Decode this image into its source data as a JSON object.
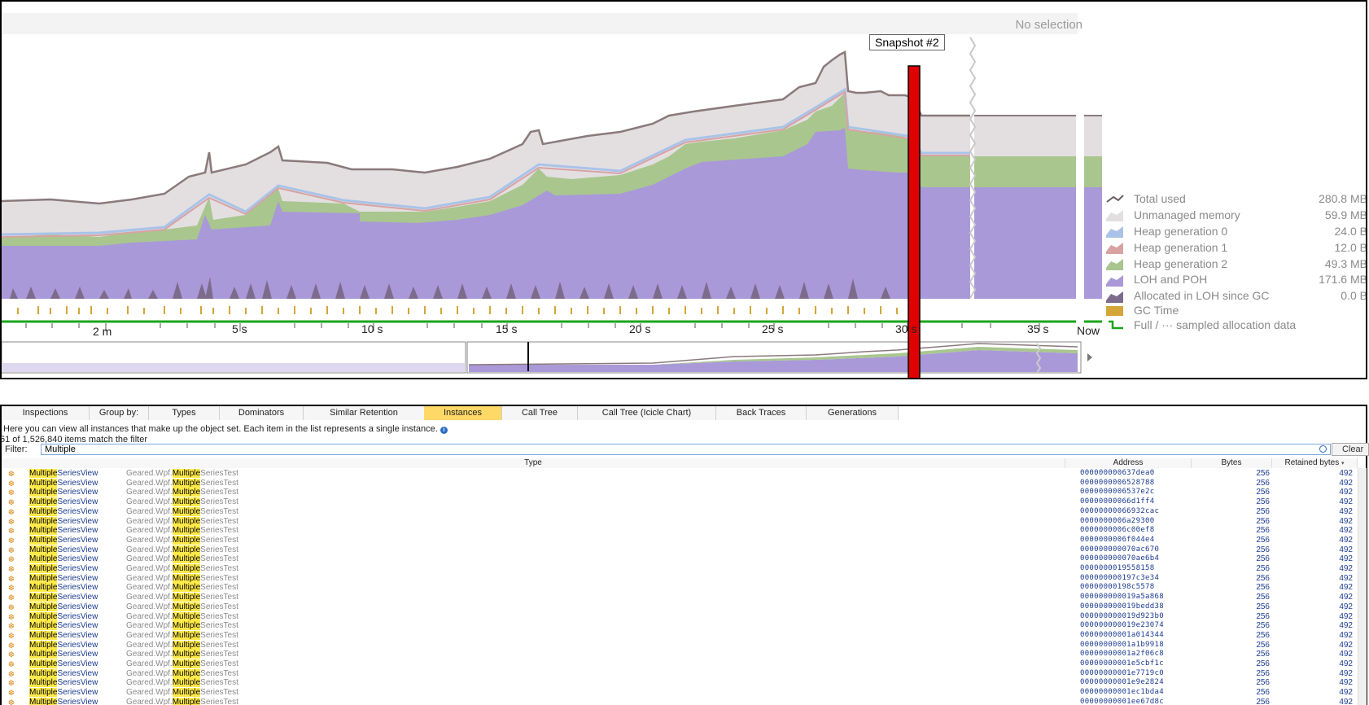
{
  "chart": {
    "status": "No selection",
    "snapshot_label": "Snapshot #2",
    "axis_ticks": [
      "2 m",
      "5 s",
      "10 s",
      "15 s",
      "20 s",
      "25 s",
      "30 s",
      "35 s",
      "Now"
    ],
    "legend": [
      {
        "label": "Total used",
        "value": "280.8 MB",
        "color": "#8a7a7c"
      },
      {
        "label": "Unmanaged memory",
        "value": "59.9 MB",
        "color": "#e3dfe1"
      },
      {
        "label": "Heap generation 0",
        "value": "24.0 B",
        "color": "#a9c3e8"
      },
      {
        "label": "Heap generation 1",
        "value": "12.0 B",
        "color": "#d9a2a2"
      },
      {
        "label": "Heap generation 2",
        "value": "49.3 MB",
        "color": "#a9c68f"
      },
      {
        "label": "LOH and POH",
        "value": "171.6 MB",
        "color": "#a999d8"
      },
      {
        "label": "Allocated in LOH since GC",
        "value": "0.0 B",
        "color": "#7d6b8c"
      },
      {
        "label": "GC Time",
        "value": "",
        "color": "#d4a637"
      },
      {
        "label": "Full / ··· sampled allocation data",
        "value": "",
        "color": "#1aa51a"
      }
    ]
  },
  "tabs": [
    {
      "label": "Inspections",
      "active": false
    },
    {
      "label": "Group by:",
      "active": false
    },
    {
      "label": "Types",
      "active": false
    },
    {
      "label": "Dominators",
      "active": false
    },
    {
      "label": "Similar Retention",
      "active": false
    },
    {
      "label": "Instances",
      "active": true
    },
    {
      "label": "Call Tree",
      "active": false
    },
    {
      "label": "Call Tree (Icicle Chart)",
      "active": false
    },
    {
      "label": "Back Traces",
      "active": false
    },
    {
      "label": "Generations",
      "active": false
    }
  ],
  "description": "Here you can view all instances that make up the object set. Each item in the list represents a single instance.",
  "match_count": "51 of 1,526,840 items match the filter",
  "filter": {
    "label": "Filter:",
    "value": "Multiple",
    "clear_label": "Clear"
  },
  "columns": {
    "type": "Type",
    "address": "Address",
    "bytes": "Bytes",
    "retained": "Retained bytes"
  },
  "row_type": {
    "highlight": "Multiple",
    "suffix": "SeriesView",
    "ns_prefix": "Geared.Wpf.",
    "ns_highlight": "Multiple",
    "ns_suffix": "SeriesTest"
  },
  "rows": [
    {
      "address": "000000000637dea0",
      "bytes": "256",
      "retained": "492"
    },
    {
      "address": "0000000006528788",
      "bytes": "256",
      "retained": "492"
    },
    {
      "address": "0000000006537e2c",
      "bytes": "256",
      "retained": "492"
    },
    {
      "address": "00000000066d1ff4",
      "bytes": "256",
      "retained": "492"
    },
    {
      "address": "00000000066932cac",
      "bytes": "256",
      "retained": "492"
    },
    {
      "address": "0000000006a29300",
      "bytes": "256",
      "retained": "492"
    },
    {
      "address": "0000000006c00ef8",
      "bytes": "256",
      "retained": "492"
    },
    {
      "address": "0000000006f044e4",
      "bytes": "256",
      "retained": "492"
    },
    {
      "address": "000000000070ac670",
      "bytes": "256",
      "retained": "492"
    },
    {
      "address": "000000000070ae6b4",
      "bytes": "256",
      "retained": "492"
    },
    {
      "address": "0000000019558158",
      "bytes": "256",
      "retained": "492"
    },
    {
      "address": "000000000197c3e34",
      "bytes": "256",
      "retained": "492"
    },
    {
      "address": "00000000198c5578",
      "bytes": "256",
      "retained": "492"
    },
    {
      "address": "000000000019a5a868",
      "bytes": "256",
      "retained": "492"
    },
    {
      "address": "000000000019bedd38",
      "bytes": "256",
      "retained": "492"
    },
    {
      "address": "000000000019d923b0",
      "bytes": "256",
      "retained": "492"
    },
    {
      "address": "000000000019e23074",
      "bytes": "256",
      "retained": "492"
    },
    {
      "address": "00000000001a014344",
      "bytes": "256",
      "retained": "492"
    },
    {
      "address": "00000000001a1b9918",
      "bytes": "256",
      "retained": "492"
    },
    {
      "address": "00000000001a2f06c8",
      "bytes": "256",
      "retained": "492"
    },
    {
      "address": "00000000001e5cbf1c",
      "bytes": "256",
      "retained": "492"
    },
    {
      "address": "00000000001e7719c0",
      "bytes": "256",
      "retained": "492"
    },
    {
      "address": "00000000001e9e2824",
      "bytes": "256",
      "retained": "492"
    },
    {
      "address": "00000000001ec1bda4",
      "bytes": "256",
      "retained": "492"
    },
    {
      "address": "00000000001ee67d8c",
      "bytes": "256",
      "retained": "492"
    }
  ]
}
